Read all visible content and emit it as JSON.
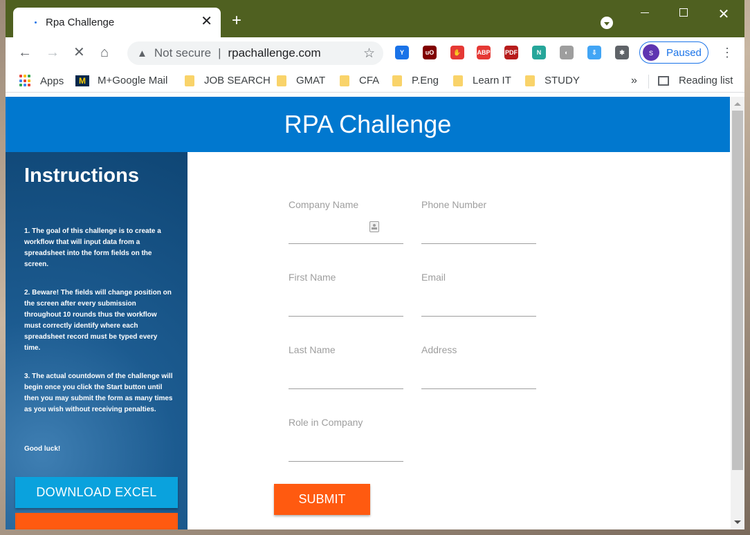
{
  "browser": {
    "tab_title": "Rpa Challenge",
    "tab_close": "✕",
    "new_tab": "+",
    "omnibox": {
      "security_label": "Not secure",
      "separator": "|",
      "url": "rpachallenge.com"
    },
    "profile_initial": "s",
    "profile_status": "Paused",
    "extensions": [
      {
        "name": "y-icon",
        "label": "Y",
        "color": "#1a73e8"
      },
      {
        "name": "ublock-icon",
        "label": "uO",
        "color": "#800000"
      },
      {
        "name": "stop-icon",
        "label": "✋",
        "color": "#e53935"
      },
      {
        "name": "adblock-plus-icon",
        "label": "ABP",
        "color": "#e53935"
      },
      {
        "name": "pdf-icon",
        "label": "PDF",
        "color": "#b71c1c"
      },
      {
        "name": "n-icon",
        "label": "N",
        "color": "#26a69a"
      },
      {
        "name": "mouse-icon",
        "label": "◐",
        "color": "#9e9e9e"
      },
      {
        "name": "download-icon",
        "label": "⇩",
        "color": "#42a5f5"
      },
      {
        "name": "puzzle-icon",
        "label": "✱",
        "color": "#5f6368"
      }
    ],
    "bookmarks": [
      {
        "name": "bookmark-apps",
        "label": "Apps",
        "kind": "apps"
      },
      {
        "name": "bookmark-m-google-mail",
        "label": "M+Google Mail",
        "kind": "m"
      },
      {
        "name": "bookmark-job-search",
        "label": "JOB SEARCH",
        "kind": "folder"
      },
      {
        "name": "bookmark-gmat",
        "label": "GMAT",
        "kind": "folder"
      },
      {
        "name": "bookmark-cfa",
        "label": "CFA",
        "kind": "folder"
      },
      {
        "name": "bookmark-p-eng",
        "label": "P.Eng",
        "kind": "folder"
      },
      {
        "name": "bookmark-learn-it",
        "label": "Learn IT",
        "kind": "folder"
      },
      {
        "name": "bookmark-study",
        "label": "STUDY",
        "kind": "folder"
      }
    ],
    "bookmarks_overflow": "»",
    "reading_list": "Reading list"
  },
  "page": {
    "title": "RPA Challenge",
    "sidebar": {
      "heading": "Instructions",
      "instructions": [
        "1. The goal of this challenge is to create a workflow that will input data from a spreadsheet into the form fields on the screen.",
        "2. Beware! The fields will change position on the screen after every submission throughout 10 rounds thus the workflow must correctly identify where each spreadsheet record must be typed every time.",
        "3. The actual countdown of the challenge will begin once you click the Start button until then you may submit the form as many times as you wish without receiving penalties.",
        "Good luck!"
      ],
      "download_button": "DOWNLOAD EXCEL"
    },
    "form": {
      "fields": {
        "company_name": "Company Name",
        "phone_number": "Phone Number",
        "first_name": "First Name",
        "email": "Email",
        "last_name": "Last Name",
        "address": "Address",
        "role": "Role in Company"
      },
      "submit_button": "SUBMIT"
    }
  },
  "colors": {
    "titlebar": "#4f6020",
    "header": "#0178cf",
    "accent_orange": "#ff5a10",
    "download_button": "#0aa2dd"
  }
}
